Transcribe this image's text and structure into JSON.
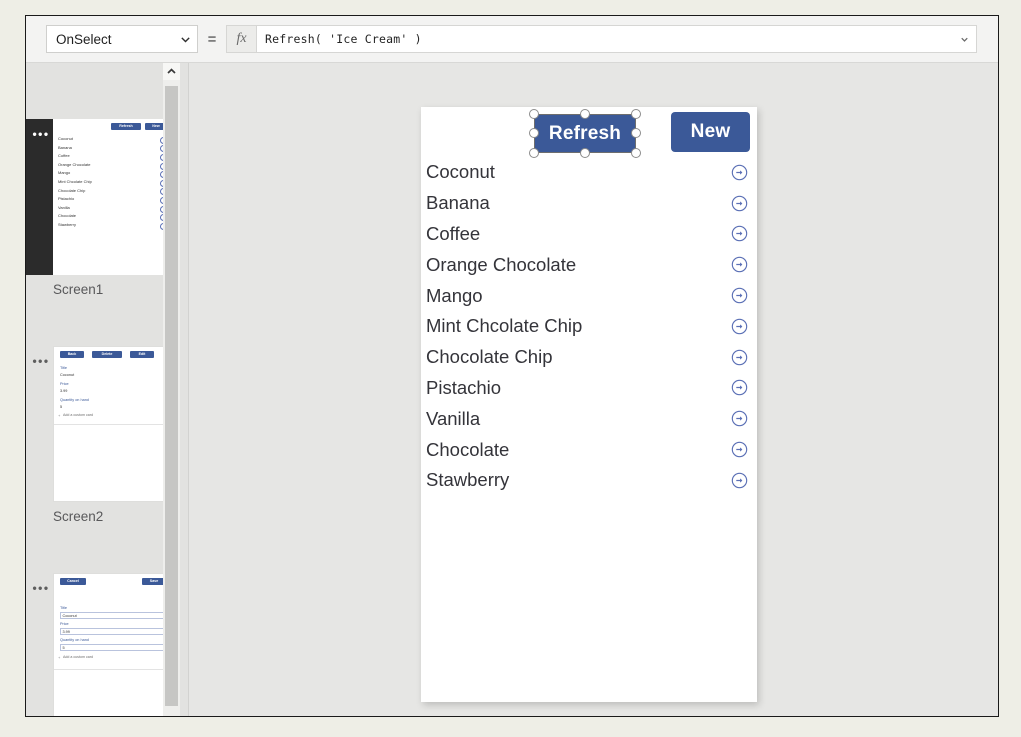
{
  "formula_bar": {
    "property": "OnSelect",
    "property_options": [
      "OnSelect"
    ],
    "equals": "=",
    "fx_icon": "fx-icon",
    "formula": "Refresh( 'Ice Cream' )",
    "dropdown_icon": "chevron-down-icon",
    "expand_icon": "chevron-down-icon"
  },
  "screens": [
    {
      "label": "Screen1",
      "menu_icon": "ellipsis-icon",
      "selected": true,
      "kind": "gallery"
    },
    {
      "label": "Screen2",
      "menu_icon": "ellipsis-icon",
      "selected": false,
      "kind": "detail"
    },
    {
      "label": "",
      "menu_icon": "ellipsis-icon",
      "selected": false,
      "kind": "edit"
    }
  ],
  "thumb_detail": {
    "buttons": [
      "Back",
      "Delete",
      "Edit"
    ],
    "fields": [
      {
        "label": "Title",
        "value": "Coconut"
      },
      {
        "label": "Price",
        "value": "3.99"
      },
      {
        "label": "Quantity on hand",
        "value": "5"
      }
    ],
    "add_card": "Add a custom card",
    "plus_icon": "plus-icon"
  },
  "thumb_edit": {
    "buttons": [
      "Cancel",
      "Save"
    ],
    "fields": [
      {
        "label": "Title",
        "value": "Coconut"
      },
      {
        "label": "Price",
        "value": "3.99"
      },
      {
        "label": "Quantity on hand",
        "value": "5"
      }
    ],
    "add_card": "Add a custom card",
    "plus_icon": "plus-icon"
  },
  "rail_scrollbar": {
    "up_icon": "chevron-up-icon"
  },
  "canvas": {
    "buttons": {
      "refresh": "Refresh",
      "new": "New"
    },
    "selected_control": "Refresh",
    "selection_handles": 8,
    "items": [
      "Coconut",
      "Banana",
      "Coffee",
      "Orange Chocolate",
      "Mango",
      "Mint Chcolate Chip",
      "Chocolate Chip",
      "Pistachio",
      "Vanilla",
      "Chocolate",
      "Stawberry"
    ],
    "row_arrow_icon": "arrow-right-circle-icon"
  },
  "colors": {
    "button_blue": "#3b5998",
    "arrow_blue": "#5a6fb5",
    "page_bg": "#eeeee6",
    "panel_bg": "#e2e2e0",
    "canvas_bg": "#e6e6e4"
  }
}
